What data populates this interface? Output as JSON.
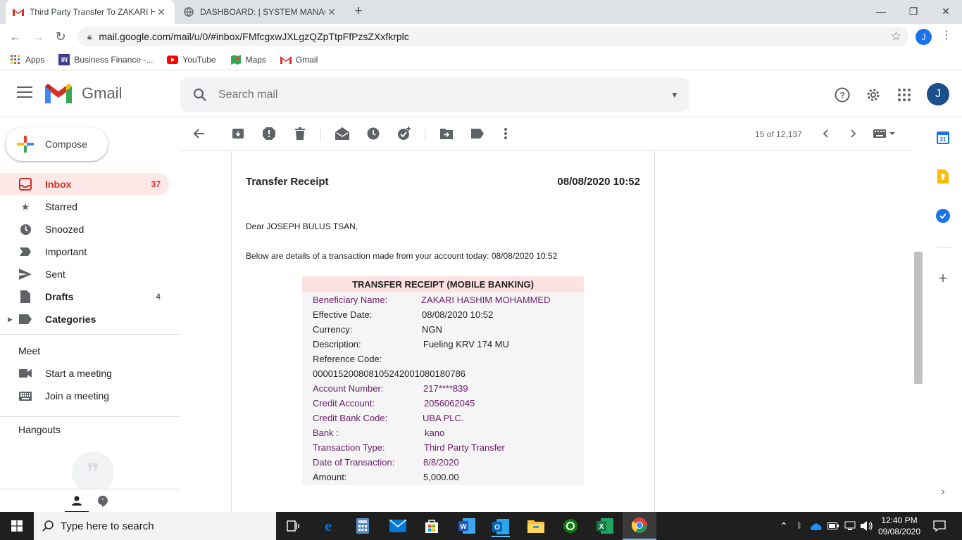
{
  "browser": {
    "tabs": [
      {
        "label": "Third Party Transfer To ZAKARI H",
        "active": true
      },
      {
        "label": "DASHBOARD: | SYSTEM MANAGE",
        "active": false
      }
    ],
    "url": "mail.google.com/mail/u/0/#inbox/FMfcgxwJXLgzQZpTtpFfPzsZXxfkrplc",
    "profile_initial": "J"
  },
  "bookmarks": [
    {
      "label": "Apps",
      "icon": "apps-grid-icon"
    },
    {
      "label": "Business Finance -...",
      "icon": "in-logo-icon"
    },
    {
      "label": "YouTube",
      "icon": "youtube-icon"
    },
    {
      "label": "Maps",
      "icon": "maps-icon"
    },
    {
      "label": "Gmail",
      "icon": "gmail-icon"
    }
  ],
  "gmail": {
    "logo_text": "Gmail",
    "search_placeholder": "Search mail",
    "avatar_initial": "J",
    "compose_label": "Compose",
    "nav": [
      {
        "label": "Inbox",
        "count": "37",
        "icon": "inbox-icon",
        "active": true
      },
      {
        "label": "Starred",
        "count": "",
        "icon": "star-icon"
      },
      {
        "label": "Snoozed",
        "count": "",
        "icon": "clock-icon"
      },
      {
        "label": "Important",
        "count": "",
        "icon": "important-icon"
      },
      {
        "label": "Sent",
        "count": "",
        "icon": "send-icon"
      },
      {
        "label": "Drafts",
        "count": "4",
        "icon": "draft-icon"
      },
      {
        "label": "Categories",
        "count": "",
        "icon": "label-icon"
      }
    ],
    "meet": {
      "heading": "Meet",
      "items": [
        {
          "label": "Start a meeting",
          "icon": "video-icon"
        },
        {
          "label": "Join a meeting",
          "icon": "keyboard-icon"
        }
      ]
    },
    "hangouts_heading": "Hangouts",
    "pager": "15 of 12,137"
  },
  "email": {
    "receipt_title": "Transfer Receipt",
    "receipt_datetime": "08/08/2020 10:52",
    "greeting": "Dear JOSEPH BULUS TSAN,",
    "intro": "Below are details of a transaction made from your account today: 08/08/2020 10:52",
    "table_heading": "TRANSFER RECEIPT (MOBILE BANKING)",
    "rows": [
      {
        "key": "Beneficiary Name:",
        "value": "ZAKARI HASHIM MOHAMMED"
      },
      {
        "key": "Effective Date:",
        "value": "08/08/2020 10:52"
      },
      {
        "key": "Currency:",
        "value": "NGN"
      },
      {
        "key": "Description:",
        "value": "Fueling KRV 174 MU"
      },
      {
        "key": "Reference Code:",
        "value": ""
      },
      {
        "key": "000015200808105242001080180786",
        "value": ""
      },
      {
        "key": "Account Number:",
        "value": "217****839"
      },
      {
        "key": "Credit Account:",
        "value": "2056062045"
      },
      {
        "key": "Credit Bank Code:",
        "value": "UBA PLC."
      },
      {
        "key": "Bank :",
        "value": "kano"
      },
      {
        "key": "Transaction Type:",
        "value": "Third Party Transfer"
      },
      {
        "key": "Date of Transaction:",
        "value": "8/8/2020"
      },
      {
        "key": "Amount:",
        "value": "5,000.00"
      }
    ]
  },
  "taskbar": {
    "search_placeholder": "Type here to search",
    "time": "12:40 PM",
    "date": "09/08/2020"
  },
  "colors": {
    "gmail_red": "#d93025",
    "inbox_active_bg": "#fce8e6",
    "receipt_header_bg": "#fde2e2",
    "receipt_purple": "#6a1b6a",
    "taskbar": "#1f1f1f"
  }
}
